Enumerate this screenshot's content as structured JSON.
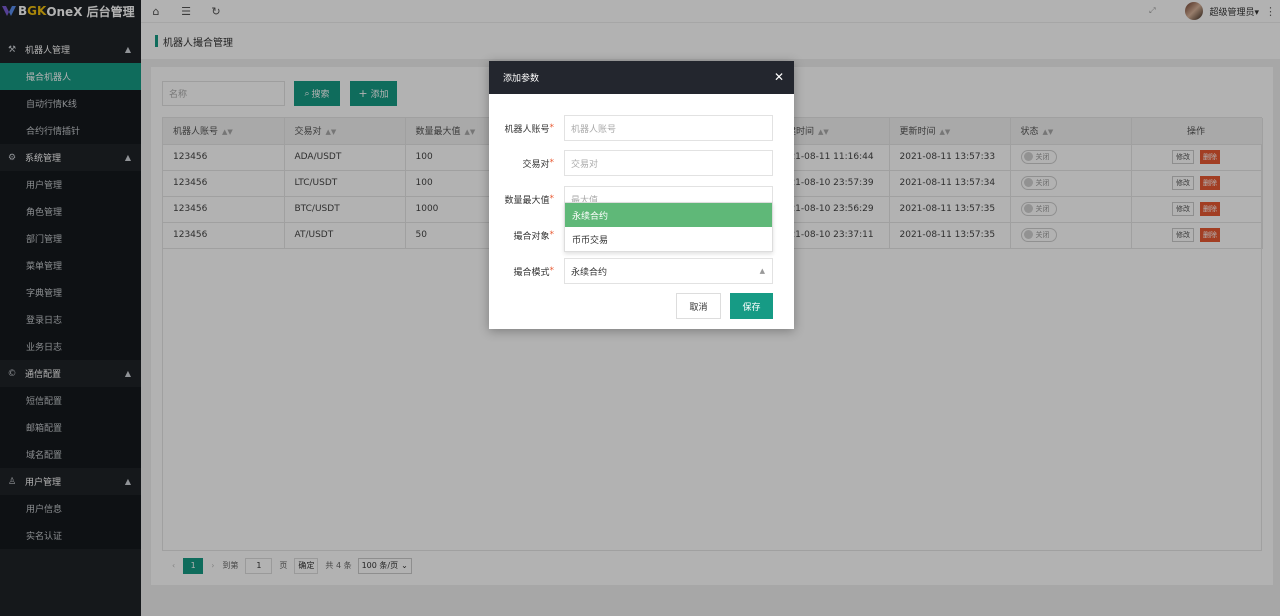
{
  "brand": {
    "prefix": "B",
    "accent": "GK",
    "rest": " OneX 后台管理"
  },
  "topbar": {
    "user_name": "超级管理员▾"
  },
  "sidebar": {
    "groups": [
      {
        "label": "机器人管理",
        "items": [
          "撮合机器人",
          "自动行情K线",
          "合约行情插针"
        ]
      },
      {
        "label": "系统管理",
        "items": [
          "用户管理",
          "角色管理",
          "部门管理",
          "菜单管理",
          "字典管理",
          "登录日志",
          "业务日志"
        ]
      },
      {
        "label": "通信配置",
        "items": [
          "短信配置",
          "邮箱配置",
          "域名配置"
        ]
      },
      {
        "label": "用户管理",
        "items": [
          "用户信息",
          "实名认证"
        ]
      }
    ]
  },
  "breadcrumb": {
    "title": "机器人撮合管理"
  },
  "search": {
    "placeholder": "名称",
    "search_label": "搜索",
    "add_label": "添加"
  },
  "table": {
    "headers": [
      "机器人账号",
      "交易对",
      "数量最大值",
      "",
      "",
      "",
      "新建时间",
      "更新时间",
      "状态",
      "操作"
    ],
    "rows": [
      {
        "account": "123456",
        "pair": "ADA/USDT",
        "max": "100",
        "created": "2021-08-11 11:16:44",
        "updated": "2021-08-11 13:57:33",
        "status": "关闭"
      },
      {
        "account": "123456",
        "pair": "LTC/USDT",
        "max": "100",
        "created": "2021-08-10 23:57:39",
        "updated": "2021-08-11 13:57:34",
        "status": "关闭"
      },
      {
        "account": "123456",
        "pair": "BTC/USDT",
        "max": "1000",
        "created": "2021-08-10 23:56:29",
        "updated": "2021-08-11 13:57:35",
        "status": "关闭"
      },
      {
        "account": "123456",
        "pair": "AT/USDT",
        "max": "50",
        "created": "2021-08-10 23:37:11",
        "updated": "2021-08-11 13:57:35",
        "status": "关闭"
      }
    ],
    "edit_label": "修改",
    "delete_label": "删除"
  },
  "pager": {
    "current": "1",
    "goto_label": "到第",
    "goto_value": "1",
    "page_unit": "页",
    "confirm": "确定",
    "total": "共 4 条",
    "page_size": "100 条/页"
  },
  "modal": {
    "title": "添加参数",
    "fields": [
      {
        "label": "机器人账号",
        "placeholder": "机器人账号"
      },
      {
        "label": "交易对",
        "placeholder": "交易对"
      },
      {
        "label": "数量最大值",
        "placeholder": "最大值"
      },
      {
        "label": "撮合对象",
        "placeholder": ""
      },
      {
        "label": "撮合模式",
        "value": "永续合约"
      }
    ],
    "dropdown_options": [
      "永续合约",
      "币币交易"
    ],
    "cancel_label": "取消",
    "save_label": "保存"
  },
  "colors": {
    "primary": "#169b85",
    "danger": "#e95a33",
    "sidebar": "#1f2328",
    "dropdown_selected": "#5fb878"
  }
}
